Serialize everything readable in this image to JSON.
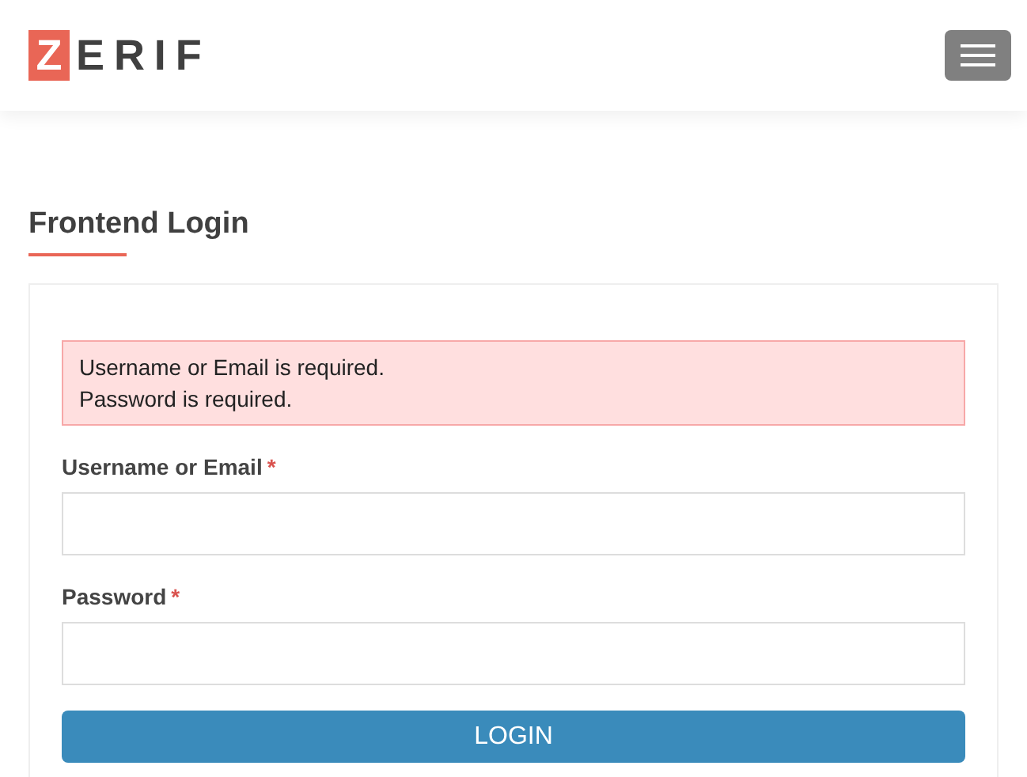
{
  "header": {
    "logo": {
      "mark": "Z",
      "text": "ERIF"
    }
  },
  "page_title": "Frontend Login",
  "errors": [
    "Username or Email is required.",
    "Password is required."
  ],
  "fields": [
    {
      "label": "Username or Email",
      "required_mark": "*"
    },
    {
      "label": "Password",
      "required_mark": "*"
    }
  ],
  "submit": "LOGIN"
}
